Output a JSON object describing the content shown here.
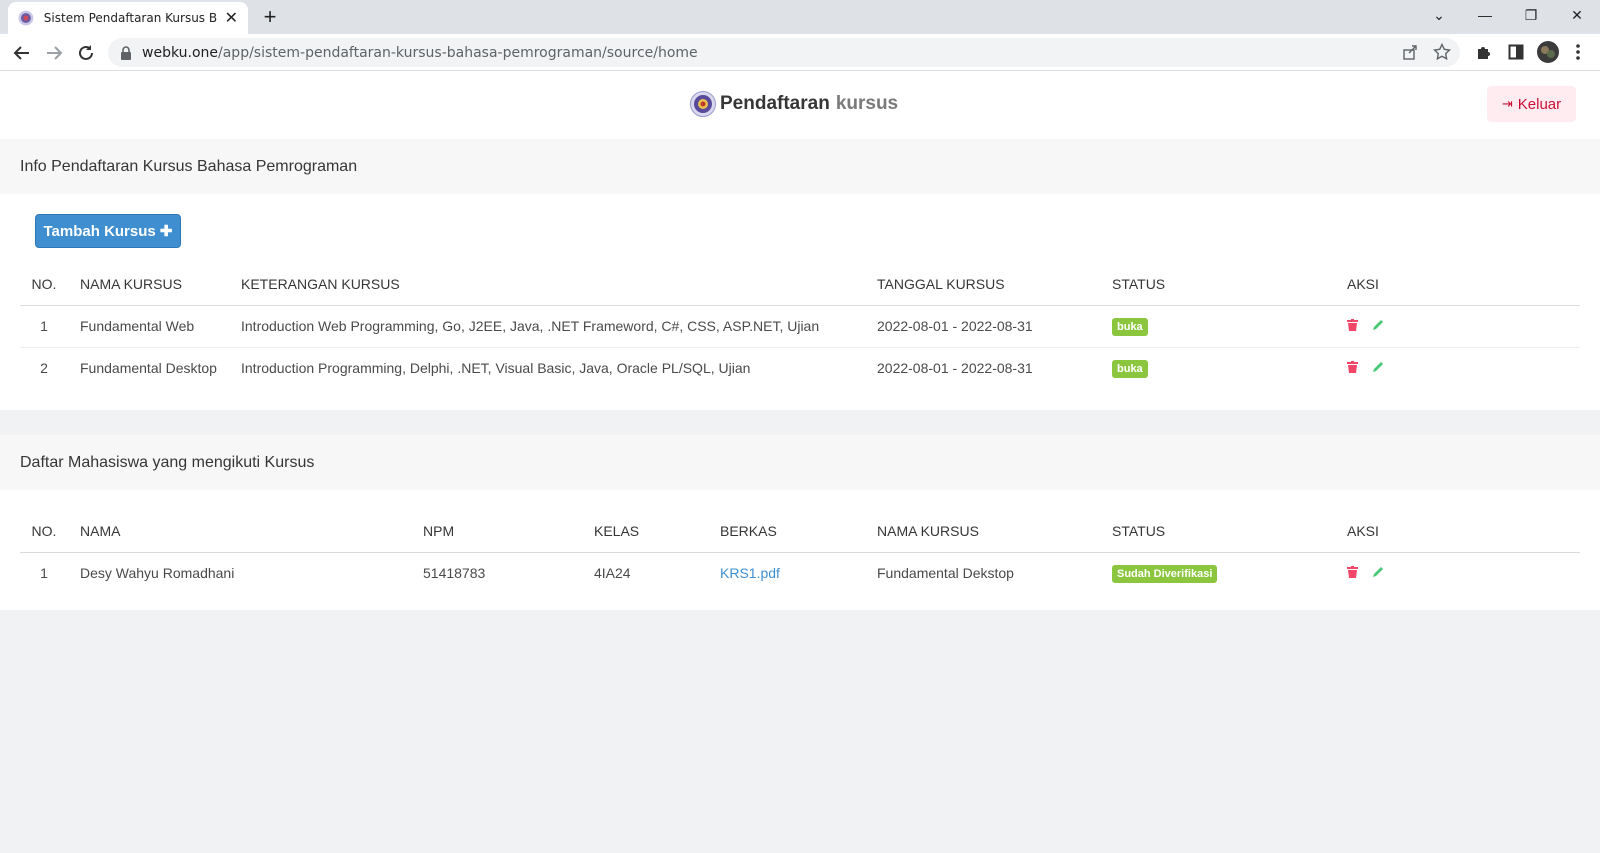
{
  "browser": {
    "tab_title": "Sistem Pendaftaran Kursus Bahasa Pemrograman",
    "url_host": "webku.one",
    "url_path": "/app/sistem-pendaftaran-kursus-bahasa-pemrograman/source/home"
  },
  "header": {
    "brand_word1": "Pendaftaran",
    "brand_word2": "kursus",
    "logout_label": "Keluar"
  },
  "courses_card": {
    "title": "Info Pendaftaran Kursus Bahasa Pemrograman",
    "add_button": "Tambah Kursus ✚",
    "columns": [
      "NO.",
      "NAMA KURSUS",
      "KETERANGAN KURSUS",
      "TANGGAL KURSUS",
      "STATUS",
      "AKSI"
    ],
    "rows": [
      {
        "no": "1",
        "name": "Fundamental Web",
        "desc": "Introduction Web Programming, Go, J2EE, Java, .NET Frameword, C#, CSS, ASP.NET, Ujian",
        "date": "2022-08-01 - 2022-08-31",
        "status": "buka"
      },
      {
        "no": "2",
        "name": "Fundamental Desktop",
        "desc": "Introduction Programming, Delphi, .NET, Visual Basic, Java, Oracle PL/SQL, Ujian",
        "date": "2022-08-01 - 2022-08-31",
        "status": "buka"
      }
    ]
  },
  "students_card": {
    "title": "Daftar Mahasiswa yang mengikuti Kursus",
    "columns": [
      "NO.",
      "NAMA",
      "NPM",
      "KELAS",
      "BERKAS",
      "NAMA KURSUS",
      "STATUS",
      "AKSI"
    ],
    "rows": [
      {
        "no": "1",
        "name": "Desy Wahyu Romadhani",
        "npm": "51418783",
        "kelas": "4IA24",
        "berkas": "KRS1.pdf",
        "course": "Fundamental Dekstop",
        "status": "Sudah Diverifikasi"
      }
    ]
  },
  "colors": {
    "primary": "#3e8ed0",
    "success_tag": "#8cc63f",
    "danger": "#f14668",
    "edit": "#48c774"
  }
}
